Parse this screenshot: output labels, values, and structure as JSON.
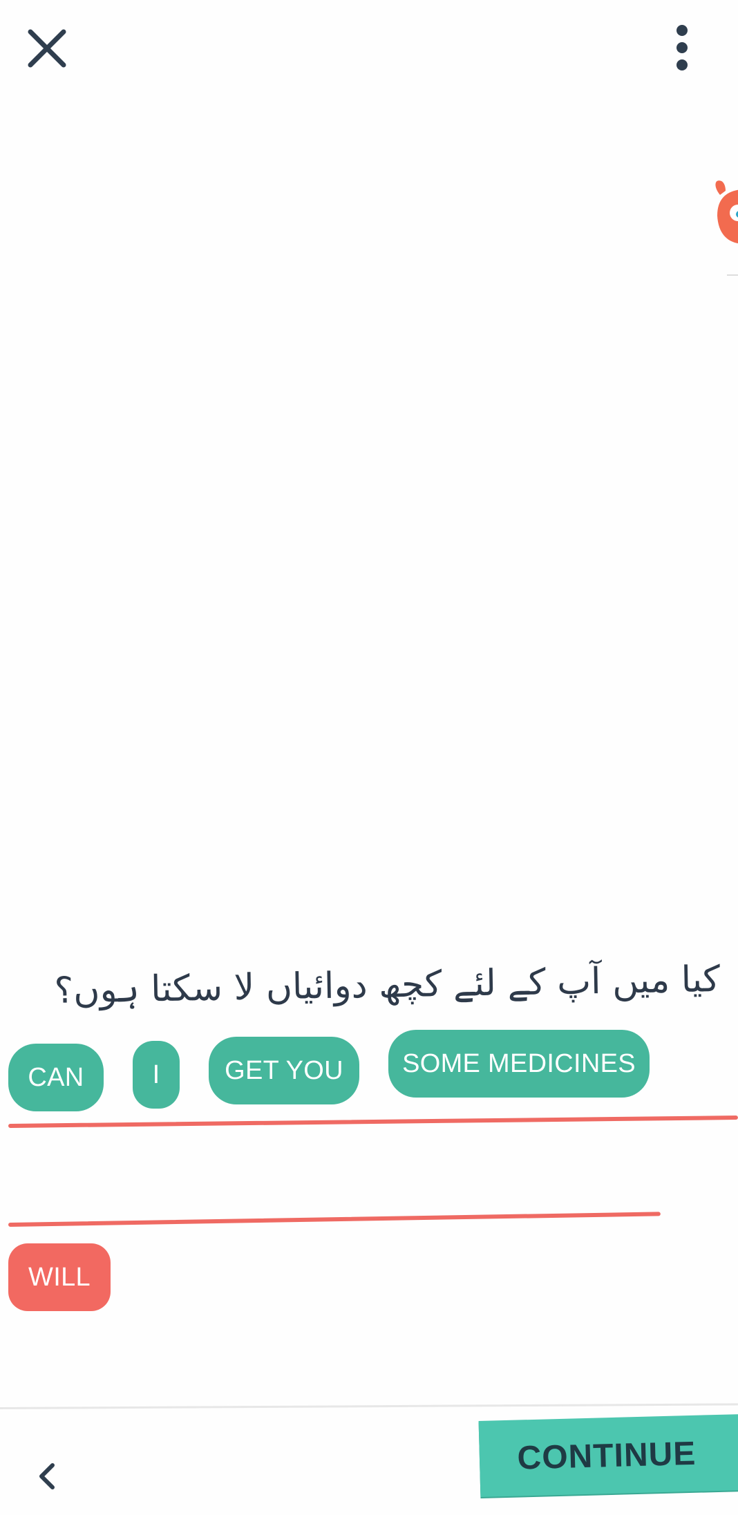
{
  "header": {
    "close_icon": "close-icon",
    "menu_icon": "more-vertical-icon"
  },
  "question": {
    "prompt": "کیا میں آپ کے لئے کچھ دوائیاں لا سکتا ہوں؟"
  },
  "answer": {
    "selected_chips": [
      "CAN",
      "I",
      "GET YOU",
      "SOME MEDICINES"
    ],
    "bank_chips": [
      "WILL"
    ]
  },
  "footer": {
    "back_icon": "chevron-left-icon",
    "continue_label": "CONTINUE"
  },
  "colors": {
    "chip_green": "#46b79c",
    "chip_coral": "#f26961",
    "line_coral": "#ef6a63",
    "continue_bg": "#4cc6af",
    "text_dark": "#2e3a4a"
  }
}
